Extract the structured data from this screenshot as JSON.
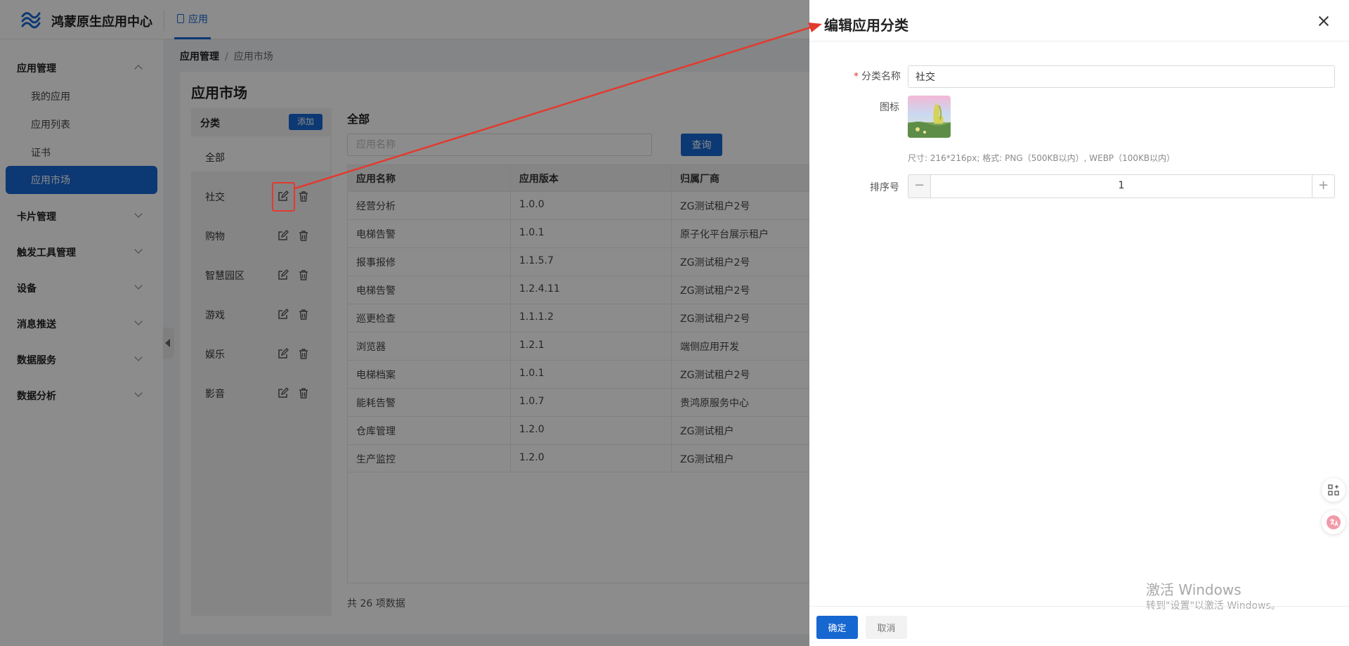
{
  "app": {
    "title": "鸿蒙原生应用中心",
    "top_tab": "应用"
  },
  "sidebar": {
    "groups": [
      {
        "label": "应用管理",
        "expanded": true,
        "items": [
          "我的应用",
          "应用列表",
          "证书",
          "应用市场"
        ],
        "active_item": "应用市场"
      },
      {
        "label": "卡片管理",
        "expanded": false
      },
      {
        "label": "触发工具管理",
        "expanded": false
      },
      {
        "label": "设备",
        "expanded": false
      },
      {
        "label": "消息推送",
        "expanded": false
      },
      {
        "label": "数据服务",
        "expanded": false
      },
      {
        "label": "数据分析",
        "expanded": false
      }
    ]
  },
  "breadcrumb": [
    "应用管理",
    "/",
    "应用市场"
  ],
  "page": {
    "title": "应用市场",
    "category_header": "分类",
    "add_label": "添加",
    "categories": [
      "全部",
      "社交",
      "购物",
      "智慧园区",
      "游戏",
      "娱乐",
      "影音"
    ]
  },
  "list": {
    "title": "全部",
    "search_placeholder": "应用名称",
    "search_button": "查询",
    "columns": [
      "应用名称",
      "应用版本",
      "归属厂商"
    ],
    "rows": [
      [
        "经营分析",
        "1.0.0",
        "ZG测试租户2号"
      ],
      [
        "电梯告警",
        "1.0.1",
        "原子化平台展示租户"
      ],
      [
        "报事报修",
        "1.1.5.7",
        "ZG测试租户2号"
      ],
      [
        "电梯告警",
        "1.2.4.11",
        "ZG测试租户2号"
      ],
      [
        "巡更检查",
        "1.1.1.2",
        "ZG测试租户2号"
      ],
      [
        "浏览器",
        "1.2.1",
        "端侧应用开发"
      ],
      [
        "电梯档案",
        "1.0.1",
        "ZG测试租户2号"
      ],
      [
        "能耗告警",
        "1.0.7",
        "贵鸿原服务中心"
      ],
      [
        "仓库管理",
        "1.2.0",
        "ZG测试租户"
      ],
      [
        "生产监控",
        "1.2.0",
        "ZG测试租户"
      ]
    ],
    "total": "共 26 项数据"
  },
  "drawer": {
    "title": "编辑应用分类",
    "name_label": "分类名称",
    "name_value": "社交",
    "icon_label": "图标",
    "icon_hint": "尺寸: 216*216px; 格式: PNG（500KB以内）, WEBP（100KB以内）",
    "order_label": "排序号",
    "order_value": "1",
    "minus": "−",
    "plus": "+",
    "ok": "确定",
    "cancel": "取消"
  },
  "watermark": {
    "line1": "激活 Windows",
    "line2": "转到\"设置\"以激活 Windows。"
  },
  "colors": {
    "primary": "#1767d1",
    "highlight": "#e33a2e"
  },
  "icons": [
    "logo-icon",
    "phone-icon",
    "chevron-icon",
    "edit-icon",
    "trash-icon",
    "close-icon",
    "grid-plus-icon",
    "translate-icon"
  ]
}
